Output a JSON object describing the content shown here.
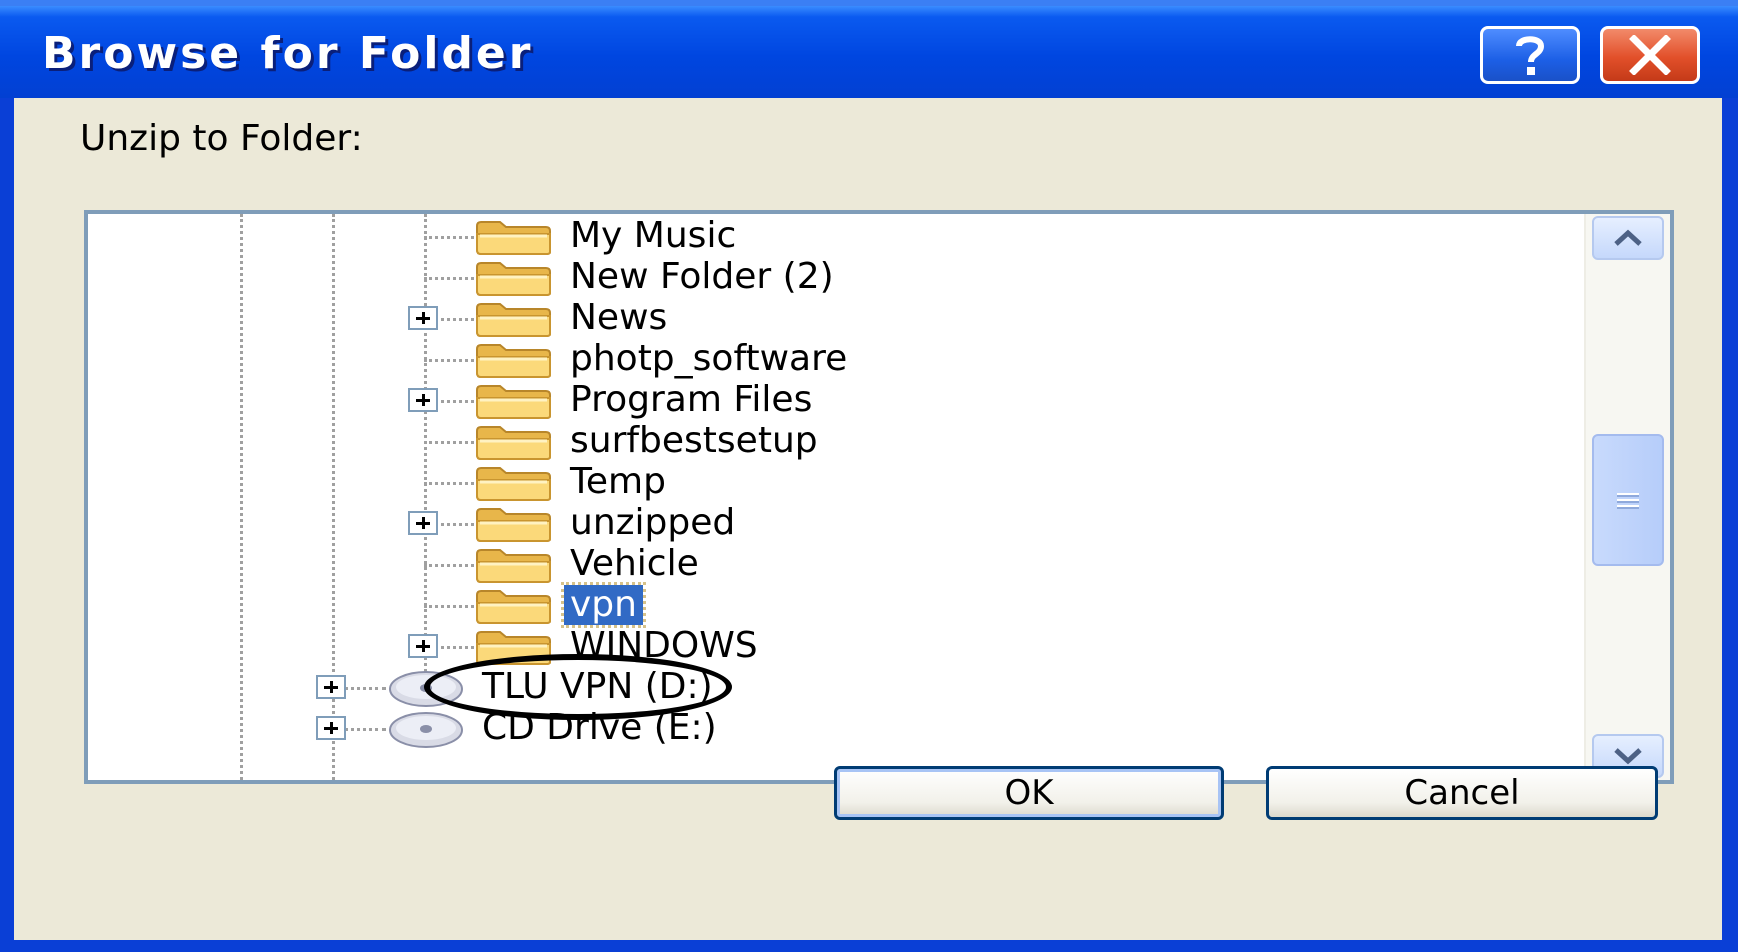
{
  "window": {
    "title": "Browse for Folder",
    "help_icon": "question-mark-icon",
    "close_icon": "close-x-icon"
  },
  "prompt_label": "Unzip to Folder:",
  "tree": {
    "items": [
      {
        "label": "My Music",
        "icon": "folder-icon",
        "expandable": false,
        "selected": false
      },
      {
        "label": "New Folder (2)",
        "icon": "folder-icon",
        "expandable": false,
        "selected": false
      },
      {
        "label": "News",
        "icon": "folder-icon",
        "expandable": true,
        "selected": false
      },
      {
        "label": "photp_software",
        "icon": "folder-icon",
        "expandable": false,
        "selected": false
      },
      {
        "label": "Program Files",
        "icon": "folder-icon",
        "expandable": true,
        "selected": false
      },
      {
        "label": "surfbestsetup",
        "icon": "folder-icon",
        "expandable": false,
        "selected": false
      },
      {
        "label": "Temp",
        "icon": "folder-icon",
        "expandable": false,
        "selected": false
      },
      {
        "label": "unzipped",
        "icon": "folder-icon",
        "expandable": true,
        "selected": false
      },
      {
        "label": "Vehicle",
        "icon": "folder-icon",
        "expandable": false,
        "selected": false
      },
      {
        "label": "vpn",
        "icon": "folder-icon",
        "expandable": false,
        "selected": true
      },
      {
        "label": "WINDOWS",
        "icon": "folder-icon",
        "expandable": true,
        "selected": false
      },
      {
        "label": "TLU VPN (D:)",
        "icon": "cd-drive-icon",
        "expandable": true,
        "selected": false
      },
      {
        "label": "CD Drive (E:)",
        "icon": "cd-drive-icon",
        "expandable": true,
        "selected": false
      }
    ]
  },
  "buttons": {
    "ok": "OK",
    "cancel": "Cancel"
  },
  "colors": {
    "title_bar": "#0046e0",
    "selection": "#316ac5",
    "dialog_face": "#ece9d8",
    "close_button": "#e2502a"
  }
}
